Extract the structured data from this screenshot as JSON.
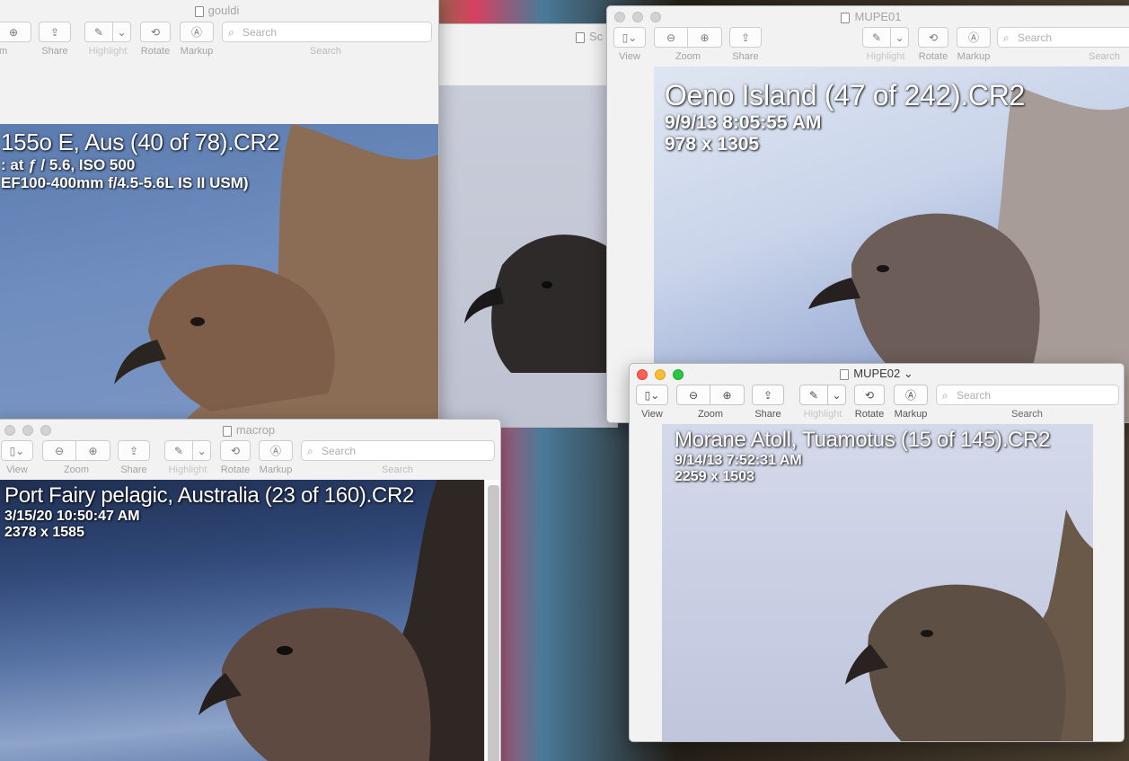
{
  "common": {
    "view": "View",
    "zoom": "Zoom",
    "share": "Share",
    "highlight": "Highlight",
    "rotate": "Rotate",
    "markup": "Markup",
    "search_placeholder": "Search",
    "search_label": "Search"
  },
  "windows": {
    "gouldi": {
      "title": "gouldi",
      "zoom_partial": "m",
      "overlay": {
        "file": "155o E, Aus (40 of 78).CR2",
        "line2": ": at ƒ / 5.6, ISO 500",
        "line3": "EF100-400mm f/4.5-5.6L IS II USM)"
      }
    },
    "sc": {
      "title_partial": "Sc"
    },
    "mupe01": {
      "title": "MUPE01",
      "overlay": {
        "file": "Oeno Island (47 of 242).CR2",
        "date": "9/9/13 8:05:55 AM",
        "dims": "978 x 1305"
      }
    },
    "macrop": {
      "title": "macrop",
      "overlay": {
        "file": "Port Fairy pelagic, Australia (23 of 160).CR2",
        "date": "3/15/20 10:50:47 AM",
        "dims": "2378 x 1585"
      }
    },
    "mupe02": {
      "title": "MUPE02 ⌄",
      "overlay": {
        "file": "Morane Atoll, Tuamotus (15 of 145).CR2",
        "date": "9/14/13 7:52:31 AM",
        "dims": "2259 x 1503"
      }
    }
  },
  "colors": {
    "close": "#fe5f57",
    "minimize": "#febc2e",
    "zoom": "#28c840"
  }
}
